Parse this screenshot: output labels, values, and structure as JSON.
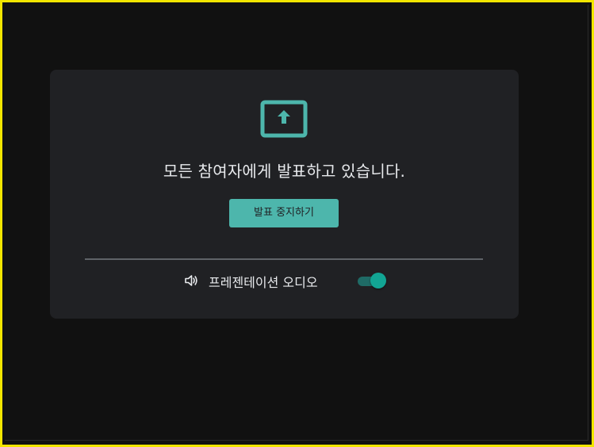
{
  "presentation": {
    "message": "모든 참여자에게 발표하고 있습니다.",
    "stop_button_label": "발표 중지하기",
    "audio_label": "프레젠테이션 오디오",
    "audio_toggle_on": true,
    "icons": {
      "present": "present-to-all-icon",
      "speaker": "speaker-icon"
    }
  },
  "colors": {
    "accent": "#4db6ac",
    "toggle_thumb": "#12a594",
    "toggle_track": "#1f6b66",
    "card_background": "#202124",
    "page_background": "#111111",
    "frame_border": "#f2e600"
  }
}
